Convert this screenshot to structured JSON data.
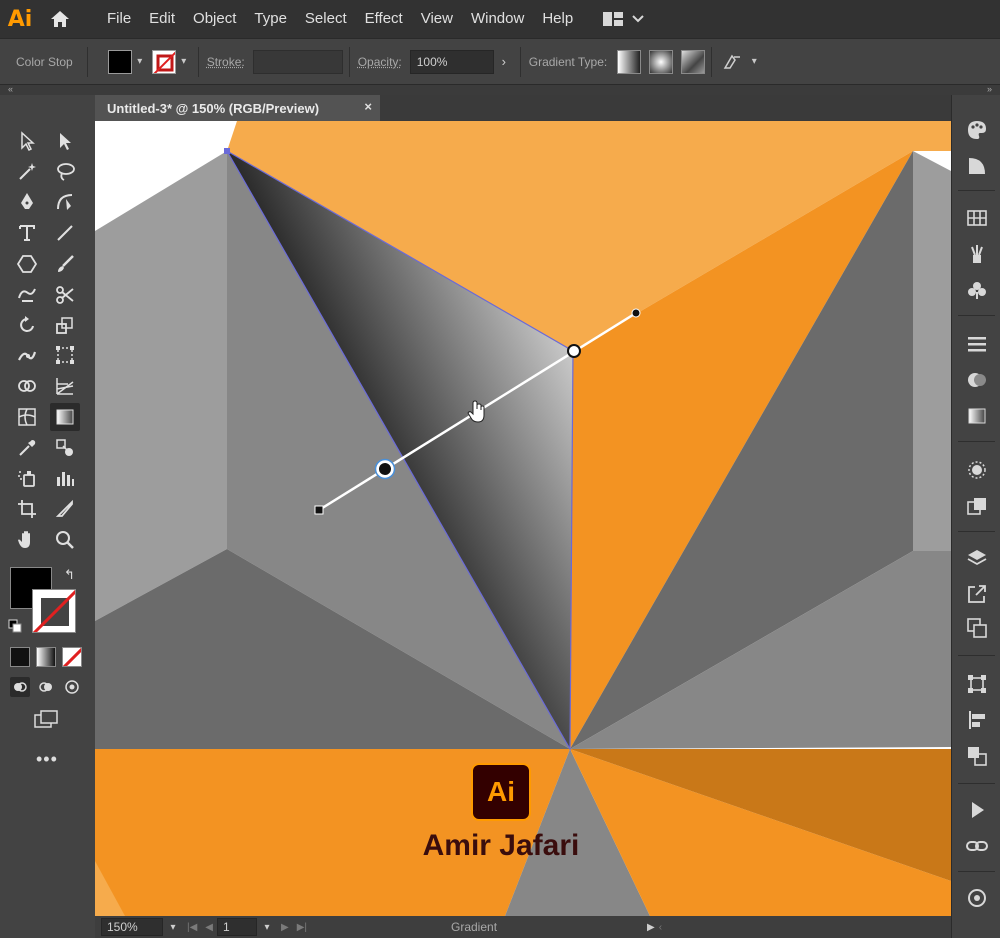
{
  "app": {
    "logo": "Ai"
  },
  "menu": [
    "File",
    "Edit",
    "Object",
    "Type",
    "Select",
    "Effect",
    "View",
    "Window",
    "Help"
  ],
  "control_bar": {
    "context_label": "Color Stop",
    "stroke_label": "Stroke:",
    "opacity_label": "Opacity:",
    "opacity_value": "100%",
    "gradient_type_label": "Gradient Type:"
  },
  "document_tab": {
    "title": "Untitled-3* @ 150% (RGB/Preview)",
    "close": "×"
  },
  "watermark": {
    "logo": "Ai",
    "author": "Amir Jafari"
  },
  "status_bar": {
    "zoom": "150%",
    "artboard": "1",
    "tool_name": "Gradient"
  },
  "icons": {
    "home": "home-icon",
    "workspace": "workspace-icon",
    "selection": "selection-icon",
    "direct_selection": "direct-selection-icon",
    "gradient_tool": "gradient-tool-icon"
  },
  "colors": {
    "accent": "#ff9a00",
    "orange_light": "#f6ab4c",
    "orange": "#f39322",
    "orange_dark": "#c97818",
    "gray_light": "#9d9d9d",
    "gray_mid": "#878787",
    "gray_dark": "#6b6b6b",
    "path_highlight": "#6a6ad8"
  }
}
